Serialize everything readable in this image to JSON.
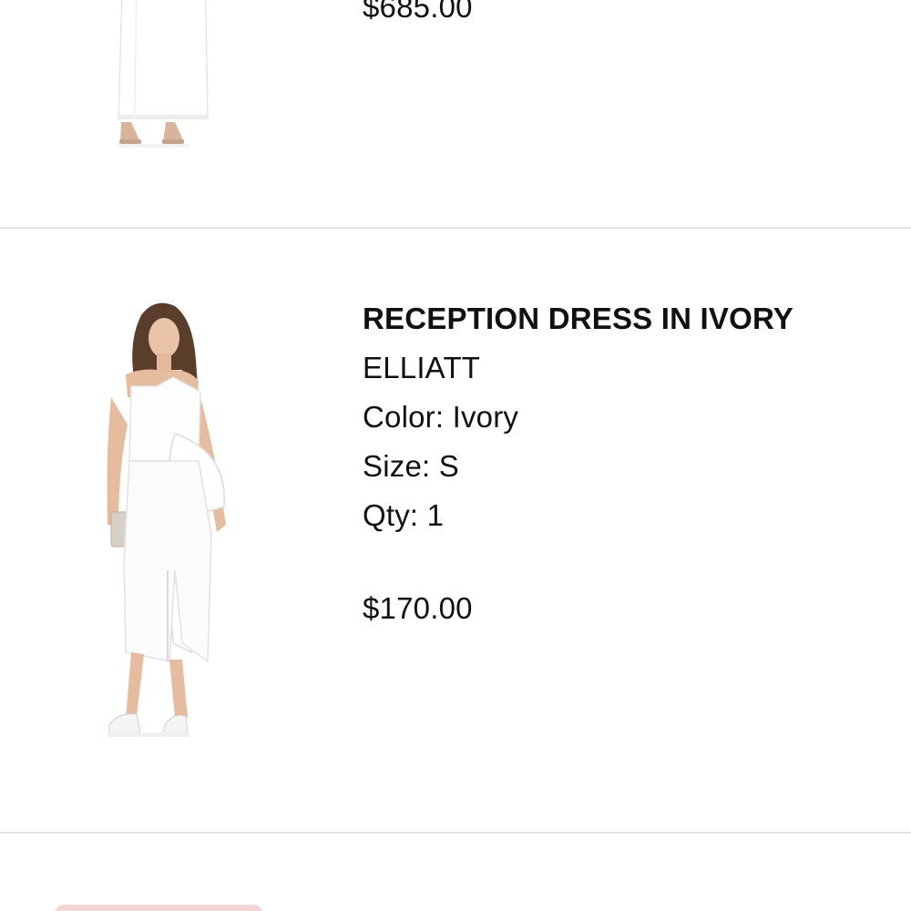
{
  "cart": {
    "items": [
      {
        "price": "$685.00",
        "image_name": "white-gown-photo"
      },
      {
        "title": "RECEPTION DRESS IN IVORY",
        "brand": "ELLIATT",
        "color_label": "Color: Ivory",
        "size_label": "Size: S",
        "qty_label": "Qty: 1",
        "price": "$170.00",
        "image_name": "ivory-dress-photo"
      }
    ]
  },
  "colors": {
    "divider": "#e3e3e3",
    "button_accent": "#f2d6d4"
  }
}
